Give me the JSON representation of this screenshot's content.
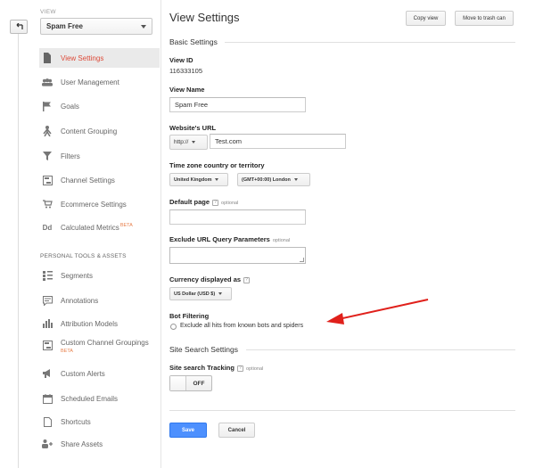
{
  "sidebar": {
    "view_label": "VIEW",
    "view_selected": "Spam Free",
    "items": [
      {
        "label": "View Settings",
        "icon": "document-icon",
        "active": true
      },
      {
        "label": "User Management",
        "icon": "users-icon"
      },
      {
        "label": "Goals",
        "icon": "flag-icon"
      },
      {
        "label": "Content Grouping",
        "icon": "person-icon"
      },
      {
        "label": "Filters",
        "icon": "funnel-icon"
      },
      {
        "label": "Channel Settings",
        "icon": "channel-icon"
      },
      {
        "label": "Ecommerce Settings",
        "icon": "cart-icon"
      },
      {
        "label": "Calculated Metrics",
        "icon": "dd-icon",
        "badge": "BETA"
      }
    ],
    "personal_heading": "PERSONAL TOOLS & ASSETS",
    "personal_items": [
      {
        "label": "Segments",
        "icon": "segments-icon"
      },
      {
        "label": "Annotations",
        "icon": "annotation-icon"
      },
      {
        "label": "Attribution Models",
        "icon": "bar-chart-icon"
      },
      {
        "label": "Custom Channel Groupings",
        "icon": "channel-icon",
        "badge": "BETA"
      },
      {
        "label": "Custom Alerts",
        "icon": "megaphone-icon"
      },
      {
        "label": "Scheduled Emails",
        "icon": "calendar-icon"
      },
      {
        "label": "Shortcuts",
        "icon": "page-icon"
      },
      {
        "label": "Share Assets",
        "icon": "share-icon"
      }
    ]
  },
  "main": {
    "title": "View Settings",
    "copy_view": "Copy view",
    "move_to_trash": "Move to trash can",
    "basic_settings": "Basic Settings",
    "view_id_label": "View ID",
    "view_id_value": "116333105",
    "view_name_label": "View Name",
    "view_name_value": "Spam Free",
    "website_url_label": "Website's URL",
    "protocol": "http://",
    "website_url_value": "Test.com",
    "timezone_label": "Time zone country or territory",
    "country": "United Kingdom",
    "timezone": "(GMT+00:00) London",
    "default_page_label": "Default page",
    "optional": "optional",
    "exclude_label": "Exclude URL Query Parameters",
    "currency_label": "Currency displayed as",
    "currency_value": "US Dollar (USD $)",
    "bot_filtering_label": "Bot Filtering",
    "bot_filtering_text": "Exclude all hits from known bots and spiders",
    "site_search_settings": "Site Search Settings",
    "site_search_tracking_label": "Site search Tracking",
    "toggle_state": "OFF",
    "save": "Save",
    "cancel": "Cancel"
  },
  "annotation": {
    "arrow_color": "#e0201b"
  },
  "colors": {
    "active_item": "#dd4b39",
    "save_button": "#4d90fe",
    "beta": "#e8804c"
  }
}
